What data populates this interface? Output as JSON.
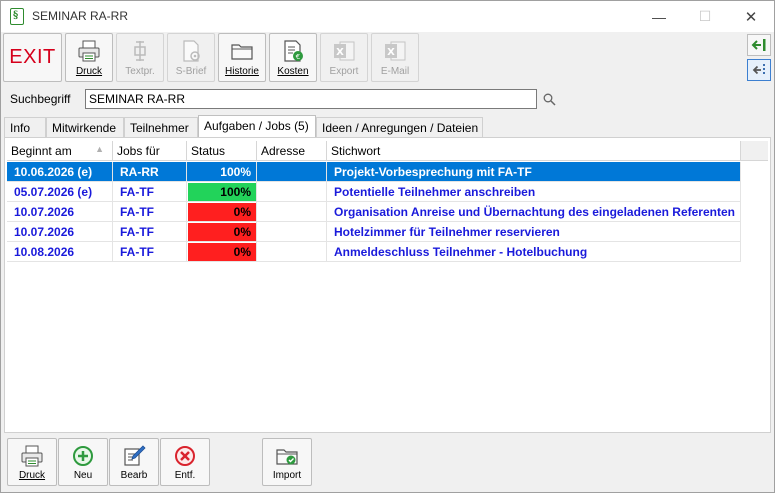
{
  "window": {
    "title": "SEMINAR RA-RR",
    "app_icon_glyph": "§",
    "controls": {
      "minimize": "—",
      "maximize": "☐",
      "close": "✕"
    }
  },
  "toolbar": {
    "exit_label": "EXIT",
    "buttons": [
      {
        "label": "Druck",
        "icon": "printer-icon",
        "enabled": true
      },
      {
        "label": "Textpr.",
        "icon": "text-print-icon",
        "enabled": false
      },
      {
        "label": "S-Brief",
        "icon": "letter-icon",
        "enabled": false
      },
      {
        "label": "Historie",
        "icon": "folder-icon",
        "enabled": true
      },
      {
        "label": "Kosten",
        "icon": "costs-icon",
        "enabled": true
      },
      {
        "label": "Export",
        "icon": "excel-icon",
        "enabled": false
      },
      {
        "label": "E-Mail",
        "icon": "excel-icon",
        "enabled": false
      }
    ],
    "side_buttons": [
      "arrow-left-bar-icon",
      "arrow-left-dashed-icon"
    ]
  },
  "search": {
    "label": "Suchbegriff",
    "value": "SEMINAR RA-RR"
  },
  "tabs": [
    {
      "label": "Info",
      "active": false
    },
    {
      "label": "Mitwirkende",
      "active": false
    },
    {
      "label": "Teilnehmer",
      "active": false
    },
    {
      "label": "Aufgaben / Jobs (5)",
      "active": true
    },
    {
      "label": "Ideen / Anregungen / Dateien",
      "active": false
    }
  ],
  "grid": {
    "columns": [
      "Beginnt am",
      "Jobs für",
      "Status",
      "Adresse",
      "Stichwort"
    ],
    "sort_indicator": "▲",
    "status_colors": {
      "done": "#22d35a",
      "open": "#ff1f1f"
    },
    "rows": [
      {
        "beginnt": "10.06.2026 (e)",
        "jobs": "RA-RR",
        "status": "100%",
        "status_fraction": 1.0,
        "status_state": "done",
        "adresse": "",
        "stichwort": "Projekt-Vorbesprechung mit FA-TF",
        "selected": true
      },
      {
        "beginnt": "05.07.2026 (e)",
        "jobs": "FA-TF",
        "status": "100%",
        "status_fraction": 1.0,
        "status_state": "done",
        "adresse": "",
        "stichwort": "Potentielle Teilnehmer anschreiben",
        "selected": false
      },
      {
        "beginnt": "10.07.2026",
        "jobs": "FA-TF",
        "status": "0%",
        "status_fraction": 0.0,
        "status_state": "open",
        "adresse": "",
        "stichwort": "Organisation Anreise und Übernachtung des eingeladenen Referenten",
        "selected": false
      },
      {
        "beginnt": "10.07.2026",
        "jobs": "FA-TF",
        "status": "0%",
        "status_fraction": 0.0,
        "status_state": "open",
        "adresse": "",
        "stichwort": "Hotelzimmer für Teilnehmer reservieren",
        "selected": false
      },
      {
        "beginnt": "10.08.2026",
        "jobs": "FA-TF",
        "status": "0%",
        "status_fraction": 0.0,
        "status_state": "open",
        "adresse": "",
        "stichwort": "Anmeldeschluss Teilnehmer - Hotelbuchung",
        "selected": false
      }
    ]
  },
  "bottom_buttons": [
    {
      "label": "Druck",
      "icon": "printer-icon"
    },
    {
      "label": "Neu",
      "icon": "plus-circle-icon"
    },
    {
      "label": "Bearb",
      "icon": "edit-icon"
    },
    {
      "label": "Entf.",
      "icon": "delete-icon"
    },
    {
      "label": "Import",
      "icon": "folder-import-icon"
    }
  ]
}
